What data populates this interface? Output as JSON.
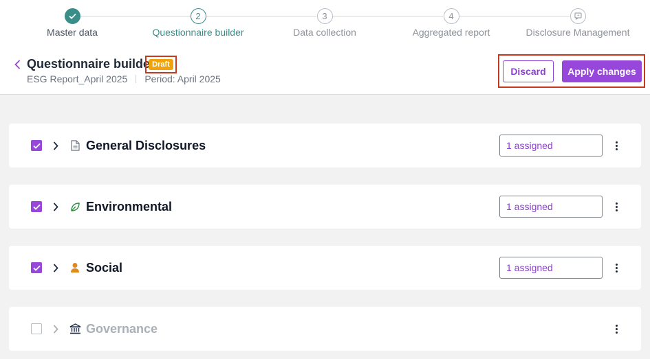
{
  "stepper": {
    "steps": [
      {
        "number": "",
        "label": "Master data",
        "state": "done"
      },
      {
        "number": "2",
        "label": "Questionnaire builder",
        "state": "active"
      },
      {
        "number": "3",
        "label": "Data collection",
        "state": "pending"
      },
      {
        "number": "4",
        "label": "Aggregated report",
        "state": "pending"
      },
      {
        "number": "",
        "label": "Disclosure Management",
        "state": "pending"
      }
    ]
  },
  "header": {
    "title": "Questionnaire builder",
    "status_badge": "Draft",
    "report_name": "ESG Report_April 2025",
    "period": "Period: April 2025"
  },
  "actions": {
    "discard_label": "Discard",
    "apply_label": "Apply changes"
  },
  "sections": [
    {
      "name": "General Disclosures",
      "icon": "document-icon",
      "checked": true,
      "assigned": "1 assigned"
    },
    {
      "name": "Environmental",
      "icon": "leaf-icon",
      "checked": true,
      "assigned": "1 assigned"
    },
    {
      "name": "Social",
      "icon": "person-icon",
      "checked": true,
      "assigned": "1 assigned"
    },
    {
      "name": "Governance",
      "icon": "bank-icon",
      "checked": false,
      "assigned": ""
    }
  ],
  "colors": {
    "accent_teal": "#3a8e8a",
    "accent_purple": "#9747d9",
    "draft_orange": "#f0a30a",
    "highlight_red": "#c53a1e"
  }
}
